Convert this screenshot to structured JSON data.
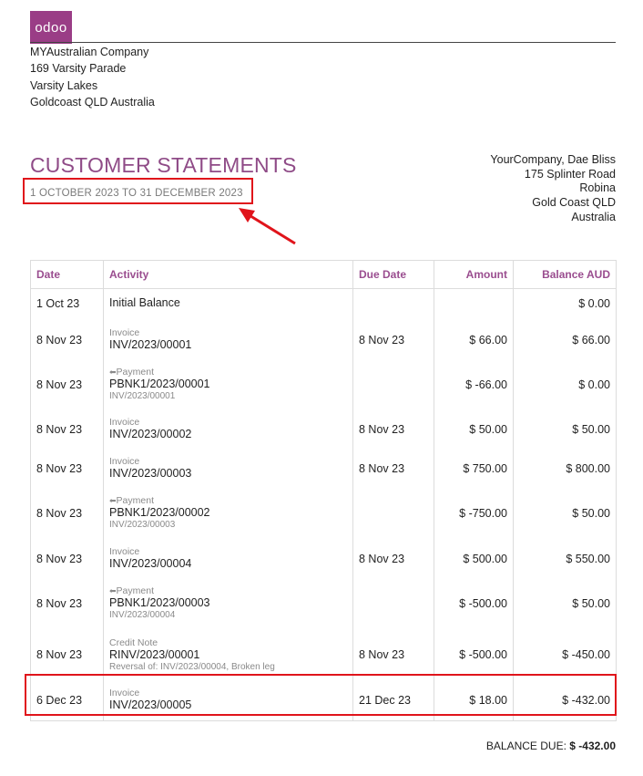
{
  "logo_text": "odoo",
  "company": {
    "name": "MYAustralian Company",
    "street": "169 Varsity Parade",
    "city": "Varsity Lakes",
    "region": "Goldcoast QLD Australia"
  },
  "title": "CUSTOMER STATEMENTS",
  "period": "1 OCTOBER 2023 TO 31 DECEMBER 2023",
  "recipient": {
    "name": "YourCompany, Dae Bliss",
    "street": "175 Splinter Road",
    "city": "Robina",
    "region": "Gold Coast QLD",
    "country": "Australia"
  },
  "table": {
    "headers": {
      "date": "Date",
      "activity": "Activity",
      "due_date": "Due Date",
      "amount": "Amount",
      "balance": "Balance AUD"
    },
    "rows": [
      {
        "date": "1 Oct 23",
        "type": "",
        "ref": "Initial Balance",
        "sub": "",
        "due": "",
        "amount": "",
        "balance": "$ 0.00"
      },
      {
        "date": "8 Nov 23",
        "type": "Invoice",
        "ref": "INV/2023/00001",
        "sub": "",
        "due": "8 Nov 23",
        "amount": "$ 66.00",
        "balance": "$ 66.00"
      },
      {
        "date": "8 Nov 23",
        "type": "Payment",
        "ref": "PBNK1/2023/00001",
        "sub": "INV/2023/00001",
        "due": "",
        "amount": "$ -66.00",
        "balance": "$ 0.00"
      },
      {
        "date": "8 Nov 23",
        "type": "Invoice",
        "ref": "INV/2023/00002",
        "sub": "",
        "due": "8 Nov 23",
        "amount": "$ 50.00",
        "balance": "$ 50.00"
      },
      {
        "date": "8 Nov 23",
        "type": "Invoice",
        "ref": "INV/2023/00003",
        "sub": "",
        "due": "8 Nov 23",
        "amount": "$ 750.00",
        "balance": "$ 800.00"
      },
      {
        "date": "8 Nov 23",
        "type": "Payment",
        "ref": "PBNK1/2023/00002",
        "sub": "INV/2023/00003",
        "due": "",
        "amount": "$ -750.00",
        "balance": "$ 50.00"
      },
      {
        "date": "8 Nov 23",
        "type": "Invoice",
        "ref": "INV/2023/00004",
        "sub": "",
        "due": "8 Nov 23",
        "amount": "$ 500.00",
        "balance": "$ 550.00"
      },
      {
        "date": "8 Nov 23",
        "type": "Payment",
        "ref": "PBNK1/2023/00003",
        "sub": "INV/2023/00004",
        "due": "",
        "amount": "$ -500.00",
        "balance": "$ 50.00"
      },
      {
        "date": "8 Nov 23",
        "type": "Credit Note",
        "ref": "RINV/2023/00001",
        "sub": "Reversal of: INV/2023/00004, Broken leg",
        "due": "8 Nov 23",
        "amount": "$ -500.00",
        "balance": "$ -450.00"
      },
      {
        "date": "6 Dec 23",
        "type": "Invoice",
        "ref": "INV/2023/00005",
        "sub": "",
        "due": "21 Dec 23",
        "amount": "$ 18.00",
        "balance": "$ -432.00"
      }
    ]
  },
  "balance_due": {
    "label": "BALANCE DUE:",
    "value": "$ -432.00"
  },
  "annotation_color": "#e0141b",
  "accent_color": "#9a4d8f"
}
